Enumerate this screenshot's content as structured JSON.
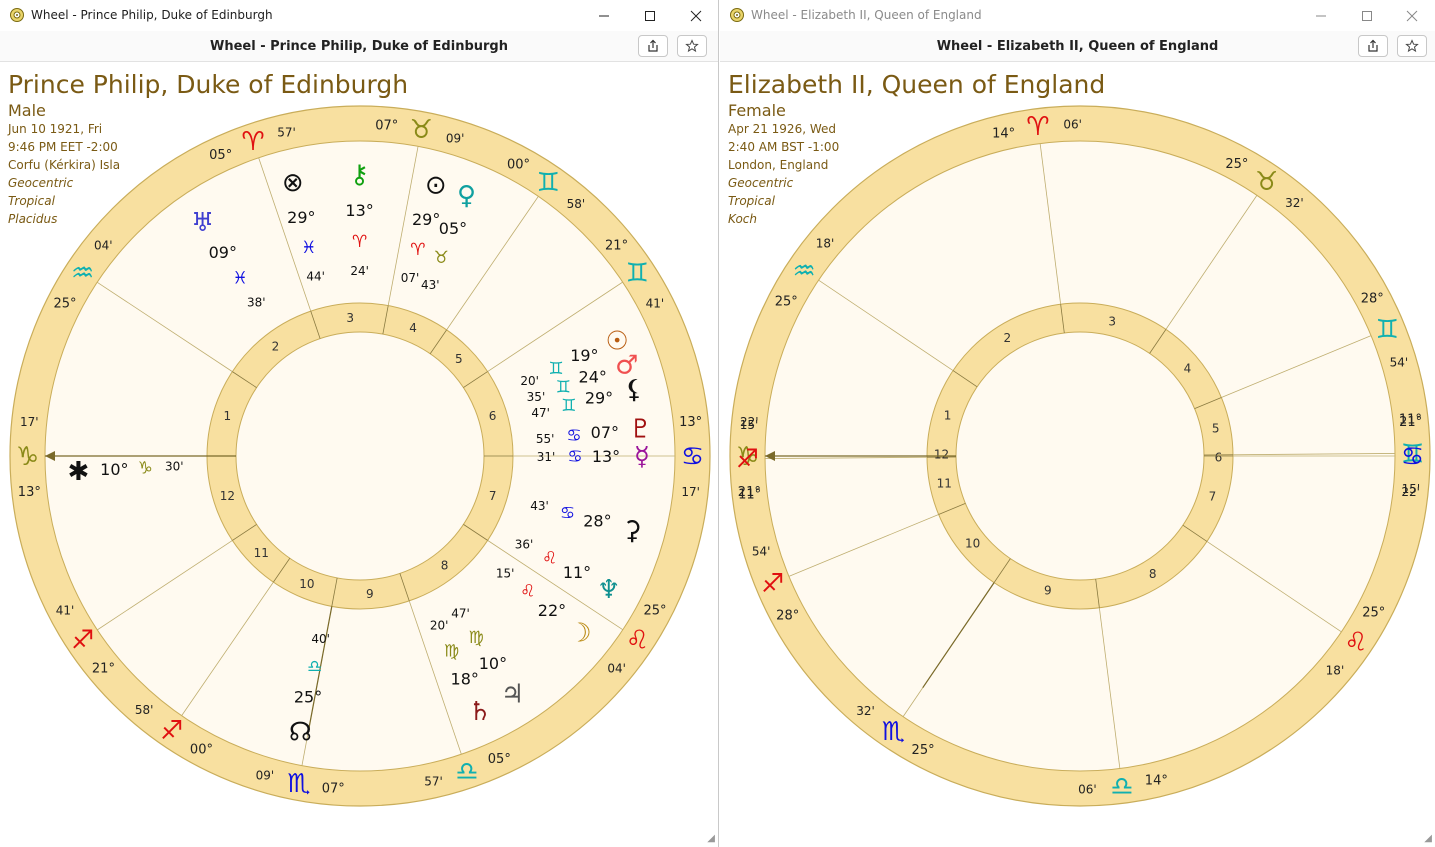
{
  "left": {
    "title": "Wheel - Prince Philip, Duke of Edinburgh",
    "header": "Wheel - Prince Philip, Duke of Edinburgh",
    "name": "Prince Philip, Duke of Edinburgh",
    "gender": "Male",
    "date": "Jun 10 1921, Fri",
    "time": "9:46 PM EET -2:00",
    "place": "Corfu (Kérkira) Isla",
    "sys1": "Geocentric",
    "sys2": "Tropical",
    "sys3": "Placidus",
    "asc": 283.5,
    "cusps": [
      283.5,
      316.97,
      354.73,
      24.12,
      47.98,
      70.0,
      103.5,
      136.97,
      174.73,
      204.12,
      227.98,
      250.0
    ],
    "cusp_labels": [
      [
        "13°",
        "cap",
        "17'"
      ],
      [
        "25°",
        "aqu",
        "04'"
      ],
      [
        "05°",
        "ari",
        "57'"
      ],
      [
        "07°",
        "tau",
        "09'"
      ],
      [
        "00°",
        "gem",
        "58'"
      ],
      [
        "21°",
        "gem",
        "41'"
      ],
      [
        "13°",
        "can",
        "17'"
      ],
      [
        "25°",
        "leo",
        "04'"
      ],
      [
        "05°",
        "lib",
        "57'"
      ],
      [
        "07°",
        "sco",
        "09'"
      ],
      [
        "00°",
        "sag",
        "58'"
      ],
      [
        "21°",
        "sag",
        "41'"
      ]
    ],
    "planets": [
      {
        "name": "ascendant-arrow",
        "lon": 283.5
      },
      {
        "name": "midheaven-arrow",
        "lon": 204.12
      }
    ],
    "planet_labels": [
      {
        "g": "node",
        "c": "#111111",
        "deg": "25°",
        "sign": "lib",
        "min": "40'",
        "lon": 205.7
      },
      {
        "g": "sat",
        "c": "#8b1a1a",
        "deg": "18°",
        "sign": "vir",
        "min": "20'",
        "lon": 168.3
      },
      {
        "g": "jup",
        "c": "#555555",
        "deg": "10°",
        "sign": "vir",
        "min": "47'",
        "lon": 160.8
      },
      {
        "g": "moon",
        "c": "#b8860b",
        "deg": "22°",
        "sign": "leo",
        "min": "15'",
        "lon": 142.2
      },
      {
        "g": "nep",
        "c": "#109090",
        "deg": "11°",
        "sign": "leo",
        "min": "36'",
        "lon": 131.6
      },
      {
        "g": "chi",
        "c": "#111111",
        "deg": "28°",
        "sign": "can",
        "min": "43'",
        "lon": 118.7
      },
      {
        "g": "mer",
        "c": "#9b159b",
        "deg": "13°",
        "sign": "can",
        "min": "31'",
        "lon": 103.5
      },
      {
        "g": "plu",
        "c": "#a01010",
        "deg": "07°",
        "sign": "can",
        "min": "55'",
        "lon": 97.9
      },
      {
        "g": "lil",
        "c": "#111111",
        "deg": "29°",
        "sign": "gem",
        "min": "47'",
        "lon": 89.8
      },
      {
        "g": "mar",
        "c": "#f05050",
        "deg": "24°",
        "sign": "gem",
        "min": "35'",
        "lon": 84.6
      },
      {
        "g": "sun",
        "c": "#b85c10",
        "deg": "19°",
        "sign": "gem",
        "min": "20'",
        "lon": 79.3
      },
      {
        "g": "ura",
        "c": "#4040d0",
        "deg": "09°",
        "sign": "pis",
        "min": "38'",
        "lon": 339.6
      },
      {
        "g": "pof",
        "c": "#111111",
        "deg": "29°",
        "sign": "pis",
        "min": "44'",
        "lon": 359.7
      },
      {
        "g": "chir",
        "c": "#10a010",
        "deg": "13°",
        "sign": "ari",
        "min": "24'",
        "lon": 13.4
      },
      {
        "g": "ven",
        "c": "#10a0a0",
        "deg": "05°",
        "sign": "tau",
        "min": "43'",
        "lon": 35.7
      },
      {
        "g": "ver",
        "c": "#111111",
        "deg": "29°",
        "sign": "ari",
        "min": "07'",
        "lon": 29.1
      }
    ],
    "extra": {
      "g": "ast",
      "c": "#111111",
      "deg": "10°",
      "sign": "cap",
      "min": "30'",
      "lon": 280.5
    }
  },
  "right": {
    "title": "Wheel - Elizabeth II, Queen of England",
    "header": "Wheel - Elizabeth II, Queen of England",
    "name": "Elizabeth II, Queen of England",
    "gender": "Female",
    "date": "Apr 21 1926, Wed",
    "time": "2:40 AM BST -1:00",
    "place": "London, England",
    "sys1": "Geocentric",
    "sys2": "Tropical",
    "sys3": "Koch",
    "asc": 291.37,
    "cusps": [
      291.37,
      325.3,
      14.1,
      55.53,
      88.9,
      110.9,
      111.37,
      145.3,
      194.1,
      235.53,
      268.9,
      290.9
    ],
    "cusp_labels": [
      [
        "21°",
        "cap",
        "22'"
      ],
      [
        "25°",
        "aqu",
        "18'"
      ],
      [
        "14°",
        "ari",
        "06'"
      ],
      [
        "25°",
        "tau",
        "32'"
      ],
      [
        "28°",
        "gem",
        "54'"
      ],
      [
        "11°",
        "gem",
        "15'"
      ],
      [
        "21°",
        "can",
        "22'"
      ],
      [
        "25°",
        "leo",
        "18'"
      ],
      [
        "14°",
        "lib",
        "06'"
      ],
      [
        "25°",
        "sco",
        "32'"
      ],
      [
        "28°",
        "sag",
        "54'"
      ],
      [
        "11°",
        "sag",
        "15'"
      ]
    ]
  },
  "resize_glyph": "◢"
}
